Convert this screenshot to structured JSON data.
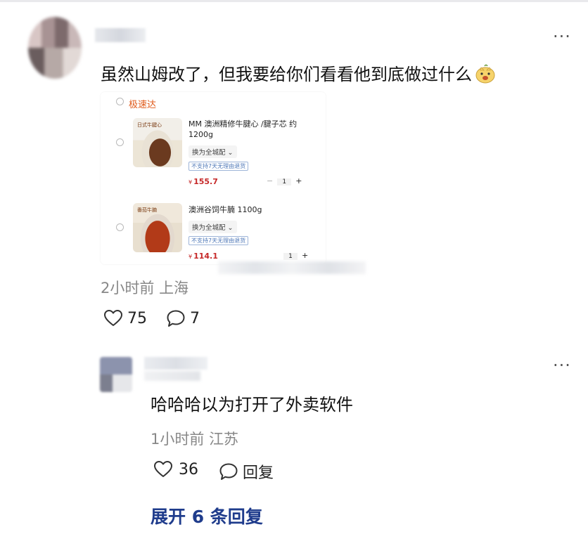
{
  "comment": {
    "text": "虽然山姆改了，但我要给你们看看他到底做过什么",
    "more_label": "···",
    "time": "2小时前",
    "location": "上海",
    "likes": "75",
    "replies": "7",
    "emoji_icon": "pig-emoji-icon"
  },
  "product_card": {
    "store_name": "极速达",
    "items": [
      {
        "name": "MM 澳洲精修牛腱心 /腱子芯 约 1200g",
        "spec": "换为全城配",
        "tag": "不支持7天无理由退货",
        "currency": "¥",
        "price": "155.7",
        "qty": "1",
        "thumb_label": "日式牛腱心"
      },
      {
        "name": "澳洲谷饲牛腩 1100g",
        "spec": "换为全城配",
        "tag": "不支持7天无理由退货",
        "currency": "¥",
        "price": "114.1",
        "qty": "1",
        "thumb_label": "番茄牛腩"
      }
    ],
    "minus": "−",
    "plus": "+"
  },
  "reply": {
    "text": "哈哈哈以为打开了外卖软件",
    "more_label": "···",
    "time": "1小时前",
    "location": "江苏",
    "likes": "36",
    "reply_label": "回复"
  },
  "expand_replies": "展开 6 条回复",
  "colors": {
    "accent_blue": "#1f3c8c",
    "price_red": "#c62828",
    "store_orange": "#e05a1a"
  }
}
